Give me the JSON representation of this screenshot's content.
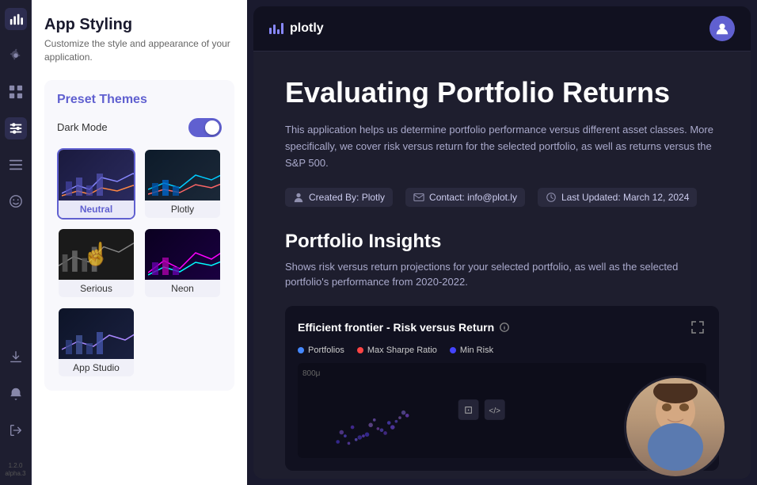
{
  "app": {
    "version": "1.2.0",
    "version_sub": "alpha.3"
  },
  "sidebar": {
    "title": "App Styling",
    "subtitle": "Customize the style and appearance of your application.",
    "preset_themes_label": "Preset Themes",
    "dark_mode_label": "Dark Mode",
    "dark_mode_enabled": true,
    "themes": [
      {
        "id": "neutral",
        "label": "Neutral",
        "selected": true
      },
      {
        "id": "plotly",
        "label": "Plotly",
        "selected": false
      },
      {
        "id": "serious",
        "label": "Serious",
        "selected": false
      },
      {
        "id": "neon",
        "label": "Neon",
        "selected": false
      },
      {
        "id": "appstudio",
        "label": "App Studio",
        "selected": false
      }
    ]
  },
  "preview": {
    "logo_text": "plotly",
    "title": "Evaluating Portfolio Returns",
    "description": "This application helps us determine portfolio performance versus different asset classes. More specifically, we cover risk versus return for the selected portfolio, as well as returns versus the S&P 500.",
    "meta": [
      {
        "icon": "person-icon",
        "text": "Created By: Plotly"
      },
      {
        "icon": "email-icon",
        "text": "Contact: info@plot.ly"
      },
      {
        "icon": "clock-icon",
        "text": "Last Updated: March 12, 2024"
      }
    ],
    "section_title": "Portfolio Insights",
    "section_desc": "Shows risk versus return projections for your selected portfolio, as well as the selected portfolio's performance from 2020-2022.",
    "chart": {
      "title": "Efficient frontier - Risk versus Return",
      "legend": [
        {
          "label": "Portfolios",
          "color": "#4488ff"
        },
        {
          "label": "Max Sharpe Ratio",
          "color": "#ff4444"
        },
        {
          "label": "Min Risk",
          "color": "#4444ff"
        }
      ],
      "y_label": "800μ"
    }
  },
  "icons": {
    "analytics": "📊",
    "gear": "⚙",
    "grid": "⊞",
    "sliders": "⧉",
    "list": "☰",
    "face": "☺",
    "download": "↓",
    "bell": "🔔",
    "exit": "⇥"
  }
}
